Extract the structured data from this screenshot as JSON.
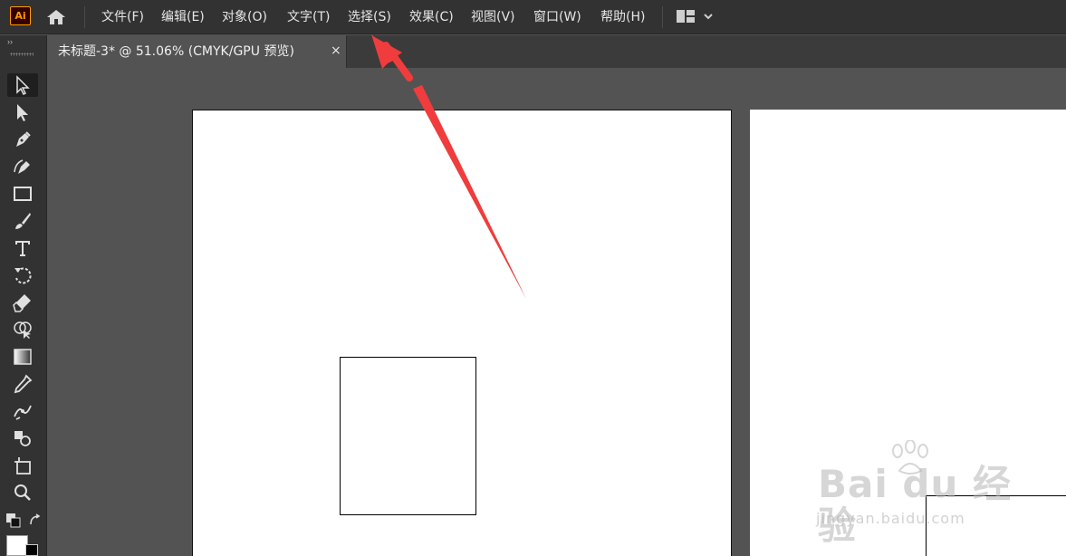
{
  "app": {
    "logo_text": "Ai",
    "accent_color": "#ff9a00"
  },
  "menu": {
    "items": [
      "文件(F)",
      "编辑(E)",
      "对象(O)",
      "文字(T)",
      "选择(S)",
      "效果(C)",
      "视图(V)",
      "窗口(W)",
      "帮助(H)"
    ]
  },
  "document_tab": {
    "title": "未标题-3* @ 51.06% (CMYK/GPU 预览)",
    "close_glyph": "×"
  },
  "panel": {
    "collapse_glyph": "››"
  },
  "tools": [
    "selection-tool",
    "direct-selection-tool",
    "pen-tool",
    "curvature-tool",
    "rectangle-tool",
    "paintbrush-tool",
    "type-tool",
    "rotate-tool",
    "eraser-tool",
    "shape-builder-tool",
    "gradient-tool",
    "eyedropper-tool",
    "puppet-warp-tool",
    "symbol-sprayer-tool",
    "artboard-tool",
    "zoom-tool"
  ],
  "watermark": {
    "brand": "Bai du 经验",
    "url": "jingyan.baidu.com"
  },
  "annotation": {
    "arrow_color": "#f03c3c"
  }
}
